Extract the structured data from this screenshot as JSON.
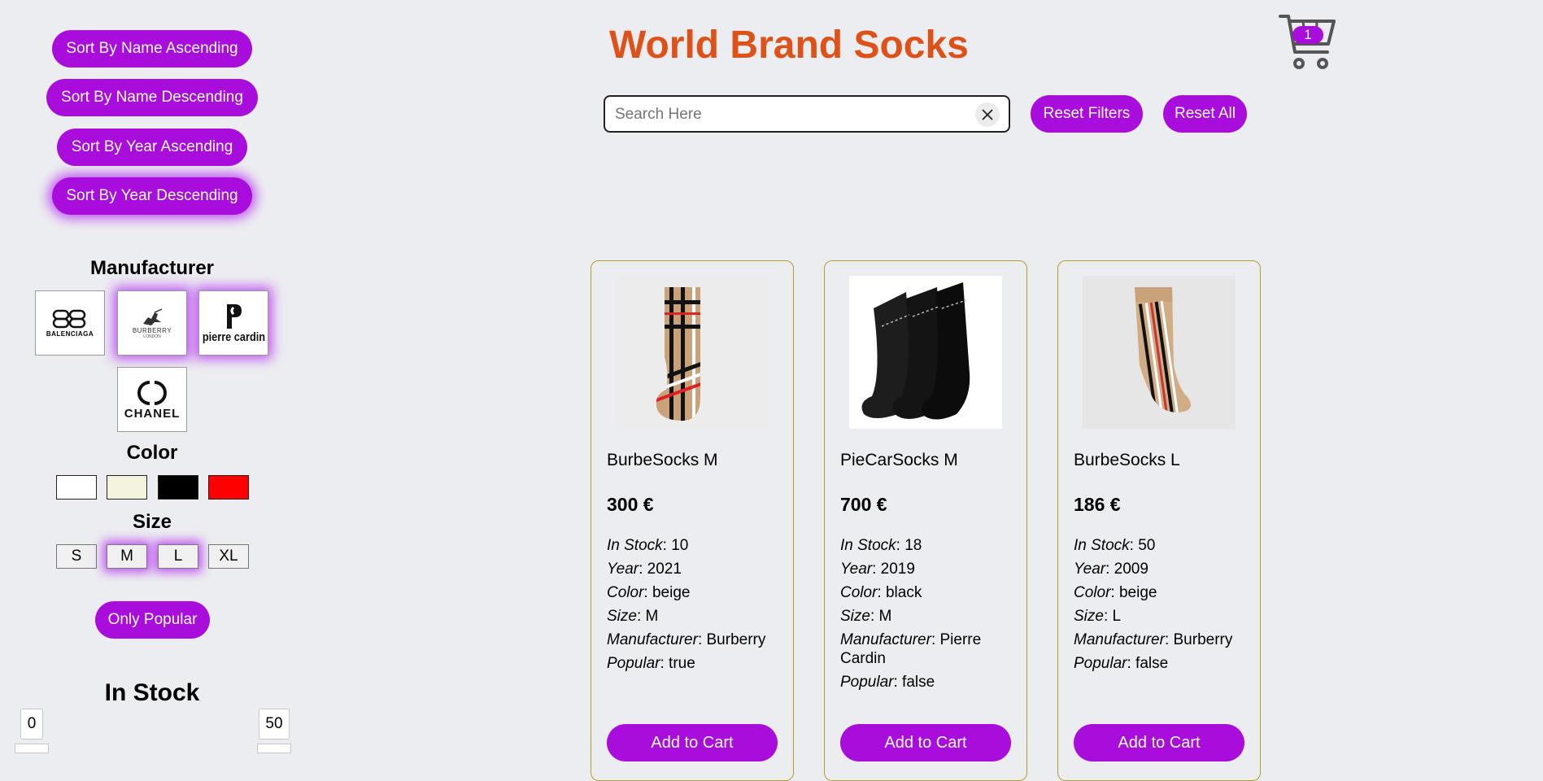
{
  "title": "World Brand Socks",
  "cart": {
    "count": "1"
  },
  "search": {
    "placeholder": "Search Here",
    "value": ""
  },
  "top_buttons": {
    "reset_filters": "Reset Filters",
    "reset_all": "Reset All"
  },
  "sort_buttons": [
    "Sort By Name Ascending",
    "Sort By Name Descending",
    "Sort By Year Ascending",
    "Sort By Year Descending"
  ],
  "filters": {
    "manufacturer_heading": "Manufacturer",
    "manufacturers": [
      {
        "name": "Balenciaga",
        "logo_text": "BALENCIAGA"
      },
      {
        "name": "Burberry",
        "logo_text": "BURBERRY",
        "logo_sub": "LONDON"
      },
      {
        "name": "Pierre Cardin",
        "logo_text": "pierre cardin"
      },
      {
        "name": "Chanel",
        "logo_text": "CHANEL"
      }
    ],
    "color_heading": "Color",
    "colors": [
      "#ffffff",
      "#f3f2dc",
      "#000000",
      "#ff0000"
    ],
    "size_heading": "Size",
    "sizes": [
      "S",
      "M",
      "L",
      "XL"
    ],
    "only_popular": "Only Popular",
    "stock_heading": "In Stock",
    "stock_min": "0",
    "stock_max": "50"
  },
  "labels": {
    "in_stock": "In Stock",
    "year": "Year",
    "color": "Color",
    "size": "Size",
    "manufacturer": "Manufacturer",
    "popular": "Popular",
    "add_to_cart": "Add to Cart"
  },
  "products": [
    {
      "name": "BurbeSocks M",
      "price": "300 €",
      "in_stock": ": 10",
      "year": ": 2021",
      "color": ": beige",
      "size": ": M",
      "manufacturer": ": Burberry",
      "popular": ": true"
    },
    {
      "name": "PieCarSocks M",
      "price": "700 €",
      "in_stock": ": 18",
      "year": ": 2019",
      "color": ": black",
      "size": ": M",
      "manufacturer": ": Pierre Cardin",
      "popular": ": false"
    },
    {
      "name": "BurbeSocks L",
      "price": "186 €",
      "in_stock": ": 50",
      "year": ": 2009",
      "color": ": beige",
      "size": ": L",
      "manufacturer": ": Burberry",
      "popular": ": false"
    }
  ]
}
